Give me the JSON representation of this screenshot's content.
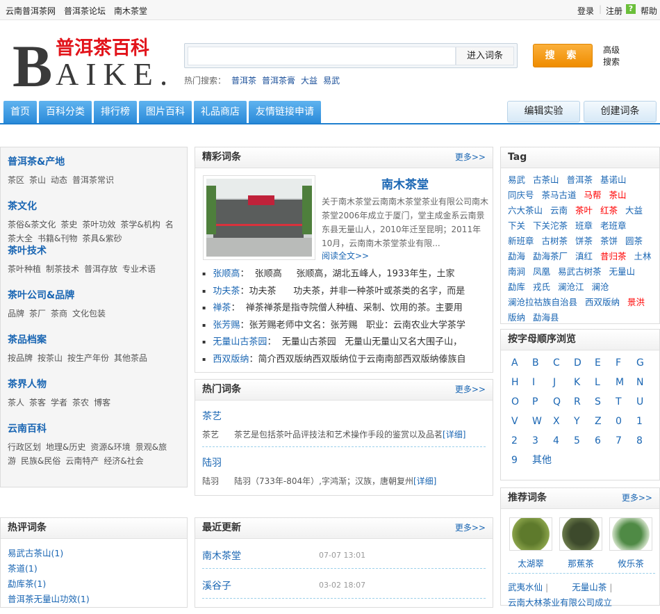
{
  "topbar": {
    "links": [
      "云南普洱茶网",
      "普洱茶论坛",
      "南木茶堂"
    ],
    "login": "登录",
    "register": "注册",
    "help": "帮助"
  },
  "logo": {
    "cn": "普洱茶百科",
    "en": "BAIKE."
  },
  "search": {
    "value": "",
    "enter": "进入词条",
    "button": "搜 索",
    "advanced": "高级搜索",
    "hot_label": "热门搜索：",
    "hot": [
      "普洱茶",
      "普洱茶膏",
      "大益",
      "易武"
    ]
  },
  "nav": {
    "tabs": [
      "首页",
      "百科分类",
      "排行榜",
      "图片百科",
      "礼品商店",
      "友情链接申请"
    ],
    "edit": "编辑实验",
    "create": "创建词条"
  },
  "categories": [
    {
      "title": "普洱茶&产地",
      "items": [
        "茶区",
        "茶山",
        "动态",
        "普洱茶常识"
      ]
    },
    {
      "title": "茶文化",
      "items": [
        "茶俗&茶文化",
        "茶史",
        "茶叶功效",
        "茶学&机构",
        "名茶大全",
        "书籍&刊物",
        "茶具&紫砂"
      ]
    },
    {
      "title": "茶叶技术",
      "items": [
        "茶叶种植",
        "制茶技术",
        "普洱存放",
        "专业术语"
      ]
    },
    {
      "title": "茶叶公司&品牌",
      "items": [
        "品牌",
        "茶厂",
        "茶商",
        "文化包装"
      ]
    },
    {
      "title": "茶品档案",
      "items": [
        "按品牌",
        "按茶山",
        "按生产年份",
        "其他茶品"
      ]
    },
    {
      "title": "茶界人物",
      "items": [
        "茶人",
        "茶客",
        "学者",
        "茶农",
        "博客"
      ]
    },
    {
      "title": "云南百科",
      "items": [
        "行政区划",
        "地理&历史",
        "资源&环境",
        "景观&旅游",
        "民族&民俗",
        "云南特产",
        "经济&社会"
      ]
    }
  ],
  "featured": {
    "title": "精彩词条",
    "more": "更多>>",
    "name": "南木茶堂",
    "summary": "关于南木茶堂云南南木茶堂茶业有限公司南木茶堂2006年成立于厦门，堂主成金系云南景东县无量山人，2010年迁至昆明；2011年10月，云南南木茶堂茶业有限...",
    "read_more": "阅读全文>>",
    "list": [
      {
        "term": "张顺高",
        "text": "：  张顺高     张顺高，湖北五峰人，1933年生，土家"
      },
      {
        "term": "功夫茶",
        "text": "：功夫茶      功夫茶，并非一种茶叶或茶类的名字，而是"
      },
      {
        "term": "禅茶",
        "text": "：  禅茶禅茶是指寺院僧人种植、采制、饮用的茶。主要用"
      },
      {
        "term": "张芳赐",
        "text": "：张芳赐老师中文名：张芳赐   职业：云南农业大学茶学"
      },
      {
        "term": "无量山古茶园",
        "text": "：  无量山古茶园   无量山无量山又名大围子山，"
      },
      {
        "term": "西双版纳",
        "text": "：简介西双版纳西双版纳位于云南南部西双版纳傣族自"
      }
    ]
  },
  "hot_terms": {
    "title": "热门词条",
    "more": "更多>>",
    "items": [
      {
        "term": "茶艺",
        "label": "茶艺",
        "desc": "茶艺是包括茶叶品评技法和艺术操作手段的鉴赏以及品茗",
        "detail": "[详细]"
      },
      {
        "term": "陆羽",
        "label": "陆羽",
        "desc": "陆羽（733年-804年）,字鸿渐；汉族，唐朝复州",
        "detail": "[详细]"
      }
    ]
  },
  "tags": {
    "title": "Tag",
    "items": [
      {
        "t": "易武"
      },
      {
        "t": "古茶山"
      },
      {
        "t": "普洱茶"
      },
      {
        "t": "基诺山"
      },
      {
        "t": "同庆号"
      },
      {
        "t": "茶马古道"
      },
      {
        "t": "马帮",
        "red": true
      },
      {
        "t": "茶山",
        "red": true
      },
      {
        "t": "六大茶山"
      },
      {
        "t": "云南"
      },
      {
        "t": "茶叶",
        "red": true
      },
      {
        "t": "红茶",
        "red": true
      },
      {
        "t": "大益"
      },
      {
        "t": "下关"
      },
      {
        "t": "下关沱茶"
      },
      {
        "t": "班章"
      },
      {
        "t": "老班章"
      },
      {
        "t": "新班章"
      },
      {
        "t": "古树茶"
      },
      {
        "t": "饼茶"
      },
      {
        "t": "茶饼"
      },
      {
        "t": "圆茶"
      },
      {
        "t": "勐海"
      },
      {
        "t": "勐海茶厂"
      },
      {
        "t": "滇红"
      },
      {
        "t": "昔归茶",
        "red": true
      },
      {
        "t": "土林"
      },
      {
        "t": "南涧"
      },
      {
        "t": "凤凰"
      },
      {
        "t": "易武古树茶"
      },
      {
        "t": "无量山"
      },
      {
        "t": "勐库"
      },
      {
        "t": "戎氏"
      },
      {
        "t": "澜沧江"
      },
      {
        "t": "澜沧"
      },
      {
        "t": "澜沧拉祜族自治县"
      },
      {
        "t": "西双版纳"
      },
      {
        "t": "景洪",
        "red": true
      },
      {
        "t": "版纳"
      },
      {
        "t": "勐海县"
      }
    ],
    "red": "#ff0000",
    "blue": "#1a66b3"
  },
  "alphabet": {
    "title": "按字母顺序浏览",
    "letters": [
      "A",
      "B",
      "C",
      "D",
      "E",
      "F",
      "G",
      "H",
      "I",
      "J",
      "K",
      "L",
      "M",
      "N",
      "O",
      "P",
      "Q",
      "R",
      "S",
      "T",
      "U",
      "V",
      "W",
      "X",
      "Y",
      "Z",
      "0",
      "1",
      "2",
      "3",
      "4",
      "5",
      "6",
      "7",
      "8",
      "9",
      "其他"
    ]
  },
  "recommend": {
    "title": "推荐词条",
    "more": "更多>>",
    "pics": [
      "太湖翠",
      "那蕉茶",
      "攸乐茶"
    ],
    "links": [
      "武夷水仙",
      "无量山茶",
      "云南大林茶业有限公司成立"
    ]
  },
  "comments": {
    "title": "热评词条",
    "items": [
      "易武古茶山(1)",
      "茶道(1)",
      "勐库茶(1)",
      "普洱茶无量山功效(1)"
    ]
  },
  "recent": {
    "title": "最近更新",
    "more": "更多>>",
    "items": [
      {
        "term": "南木茶堂",
        "time": "07-07 13:01"
      },
      {
        "term": "溪谷子",
        "time": "03-02 18:07"
      }
    ]
  }
}
